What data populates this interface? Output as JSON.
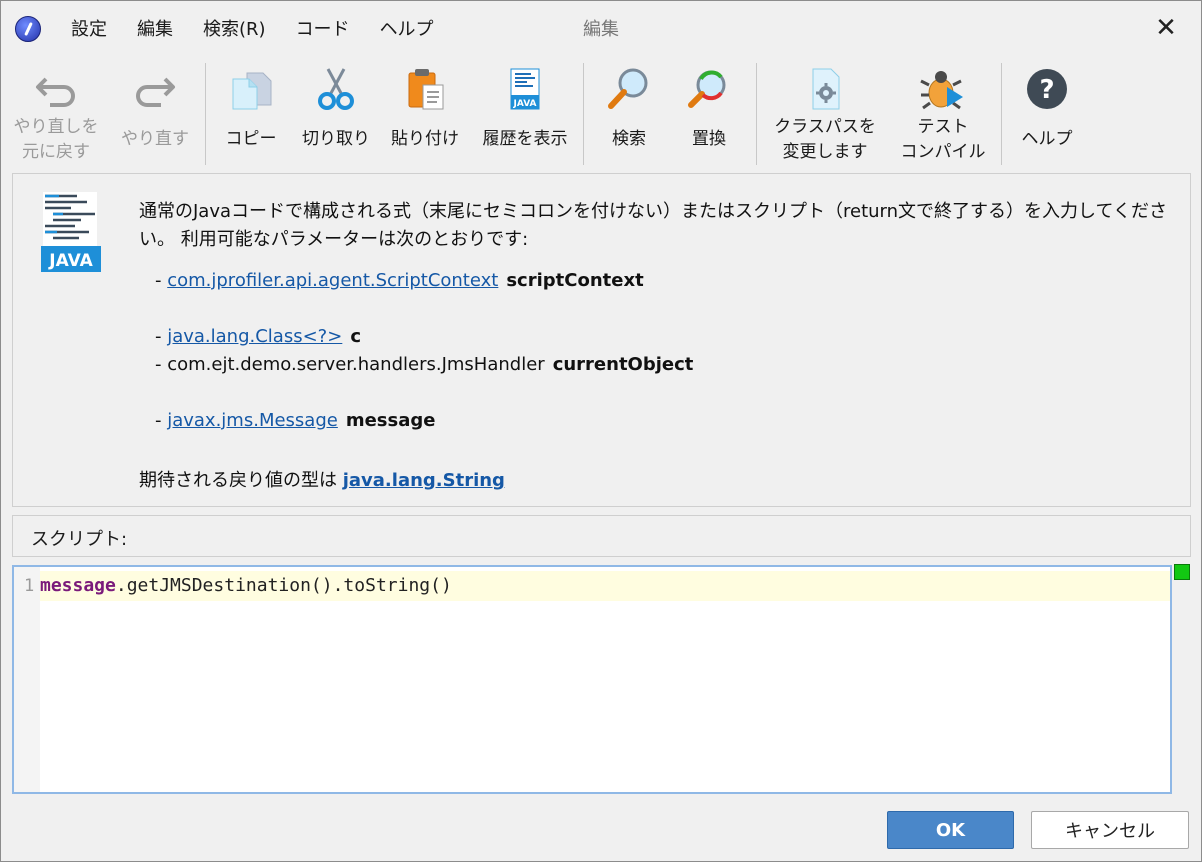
{
  "window": {
    "title": "編集"
  },
  "menu": {
    "items": [
      "設定",
      "編集",
      "検索(R)",
      "コード",
      "ヘルプ"
    ]
  },
  "toolbar": {
    "undo": "やり直しを\n元に戻す",
    "redo": "やり直す",
    "copy": "コピー",
    "cut": "切り取り",
    "paste": "貼り付け",
    "history": "履歴を表示",
    "find": "検索",
    "replace": "置換",
    "classpath": "クラスパスを\n変更します",
    "compile": "テスト\nコンパイル",
    "help": "ヘルプ"
  },
  "info": {
    "description": "通常のJavaコードで構成される式（末尾にセミコロンを付けない）またはスクリプト（return文で終了する）を入力してください。 利用可能なパラメーターは次のとおりです:",
    "params": [
      {
        "type": "com.jprofiler.api.agent.ScriptContext",
        "name": "scriptContext",
        "link": true
      },
      {
        "type": "java.lang.Class<?>",
        "name": "c",
        "link": true
      },
      {
        "type": "com.ejt.demo.server.handlers.JmsHandler",
        "name": "currentObject",
        "link": false
      },
      {
        "type": "javax.jms.Message",
        "name": "message",
        "link": true
      }
    ],
    "return_prefix": "期待される戻り値の型は",
    "return_type": "java.lang.String",
    "logo_text": "JAVA"
  },
  "script": {
    "label": "スクリプト:",
    "line_number": "1",
    "code_keyword": "message",
    "code_rest": ".getJMSDestination().toString()"
  },
  "buttons": {
    "ok": "OK",
    "cancel": "キャンセル"
  },
  "colors": {
    "accent": "#4a87c9",
    "link": "#1558a6",
    "status_ok": "#12c812"
  }
}
